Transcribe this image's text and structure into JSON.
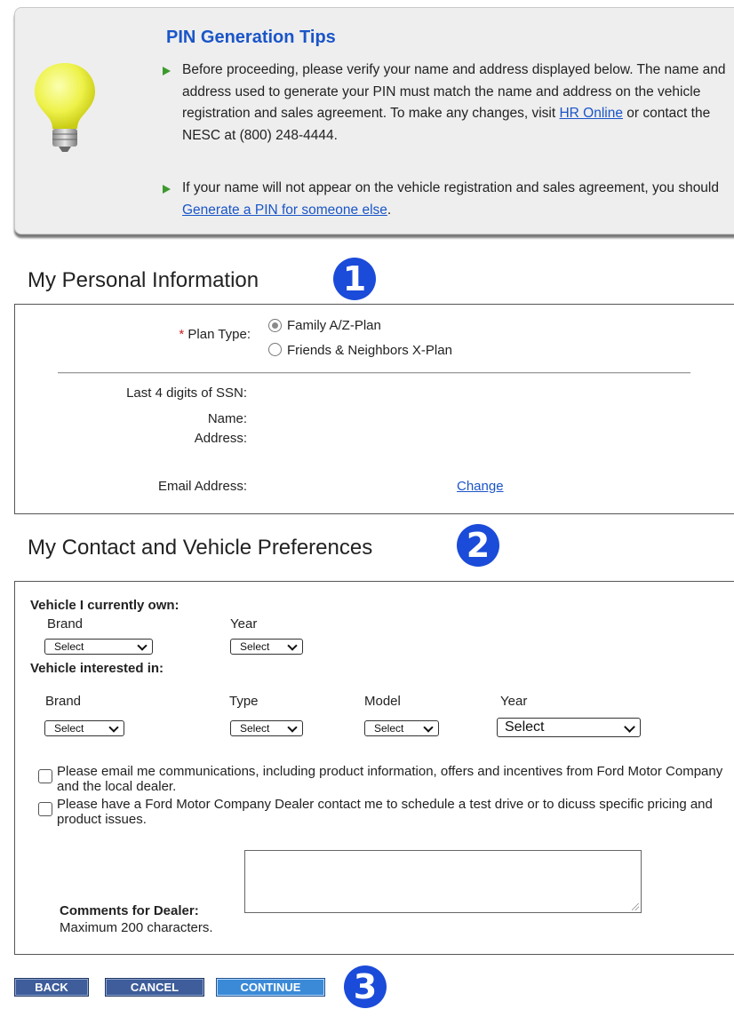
{
  "tips": {
    "title": "PIN Generation Tips",
    "tip1_text": "Before proceeding, please verify your name and address displayed below. The name and address used to generate your PIN must match the name and address on the vehicle registration and sales agreement. To make any changes, visit ",
    "tip1_link": "HR Online",
    "tip1_after": " or contact the NESC at (800) 248-4444.",
    "tip2_text": "If your name will not appear on the vehicle registration and sales agreement, you should ",
    "tip2_link": "Generate a PIN for someone else",
    "tip2_after": "."
  },
  "section1": {
    "heading": "My Personal Information",
    "badge": "1",
    "required_mark": "*",
    "plan_type_label": " Plan Type:",
    "plan_options": [
      "Family A/Z-Plan",
      "Friends & Neighbors X-Plan"
    ],
    "selected_plan": "Family A/Z-Plan",
    "ssn_label": "Last 4 digits of SSN:",
    "name_label": "Name:",
    "address_label": "Address:",
    "email_label": "Email Address:",
    "change_link": "Change"
  },
  "section2": {
    "heading": "My Contact and Vehicle Preferences",
    "badge": "2",
    "owned_heading": "Vehicle I currently own:",
    "owned": {
      "brand_label": "Brand",
      "year_label": "Year",
      "brand_value": "Select",
      "year_value": "Select"
    },
    "interested_heading": "Vehicle interested in:",
    "interested": {
      "brand_label": "Brand",
      "type_label": "Type",
      "model_label": "Model",
      "year_label": "Year",
      "brand_value": "Select",
      "type_value": "Select",
      "model_value": "Select",
      "year_value": "Select"
    },
    "checkbox_email": "Please email me communications, including product information, offers and incentives from Ford Motor Company and the local dealer.",
    "checkbox_dealer": "Please have a Ford Motor Company Dealer contact me to schedule a test drive or to dicuss specific pricing and product issues.",
    "comments_label": "Comments for Dealer:",
    "comments_hint": "Maximum 200 characters."
  },
  "buttons": {
    "back": "BACK",
    "cancel": "CANCEL",
    "continue": "CONTINUE",
    "badge": "3"
  },
  "colors": {
    "link": "#1a55c8",
    "badge": "#1b4bd9",
    "button": "#3e5d9a",
    "primary_button": "#3a8ad7",
    "tip_arrow": "#3c9a2c"
  }
}
